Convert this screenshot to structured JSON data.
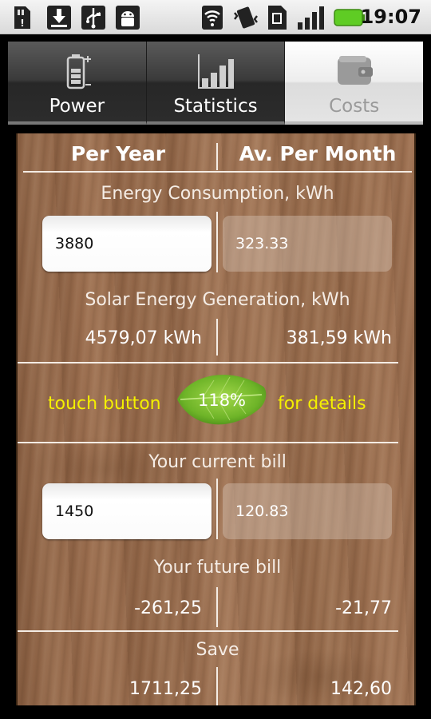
{
  "status_bar": {
    "time": "19:07",
    "icons": [
      "sd-card-icon",
      "download-icon",
      "usb-icon",
      "android-debug-icon",
      "wifi-icon",
      "vibrate-icon",
      "sim-icon",
      "signal-icon",
      "battery-icon"
    ],
    "battery_color": "#5fcc24"
  },
  "tabs": [
    {
      "label": "Power",
      "icon": "battery-icon",
      "active": false
    },
    {
      "label": "Statistics",
      "icon": "bar-chart-icon",
      "active": false
    },
    {
      "label": "Costs",
      "icon": "wallet-icon",
      "active": true
    }
  ],
  "table": {
    "col_per_year": "Per Year",
    "col_per_month": "Av. Per Month"
  },
  "energy": {
    "label": "Energy Consumption, kWh",
    "year_value": "3880",
    "month_value": "323.33"
  },
  "solar": {
    "label": "Solar Energy Generation, kWh",
    "year_value": "4579,07 kWh",
    "month_value": "381,59 kWh"
  },
  "details": {
    "left_text": "touch button",
    "percent": "118%",
    "right_text": "for details",
    "accent_color": "#f4f000",
    "leaf_color": "#7cc12e"
  },
  "current_bill": {
    "label": "Your current bill",
    "year_value": "1450",
    "month_value": "120.83"
  },
  "future_bill": {
    "label": "Your future bill",
    "year_value": "-261,25",
    "month_value": "-21,77"
  },
  "save": {
    "label": "Save",
    "year_value": "1711,25",
    "month_value": "142,60"
  }
}
